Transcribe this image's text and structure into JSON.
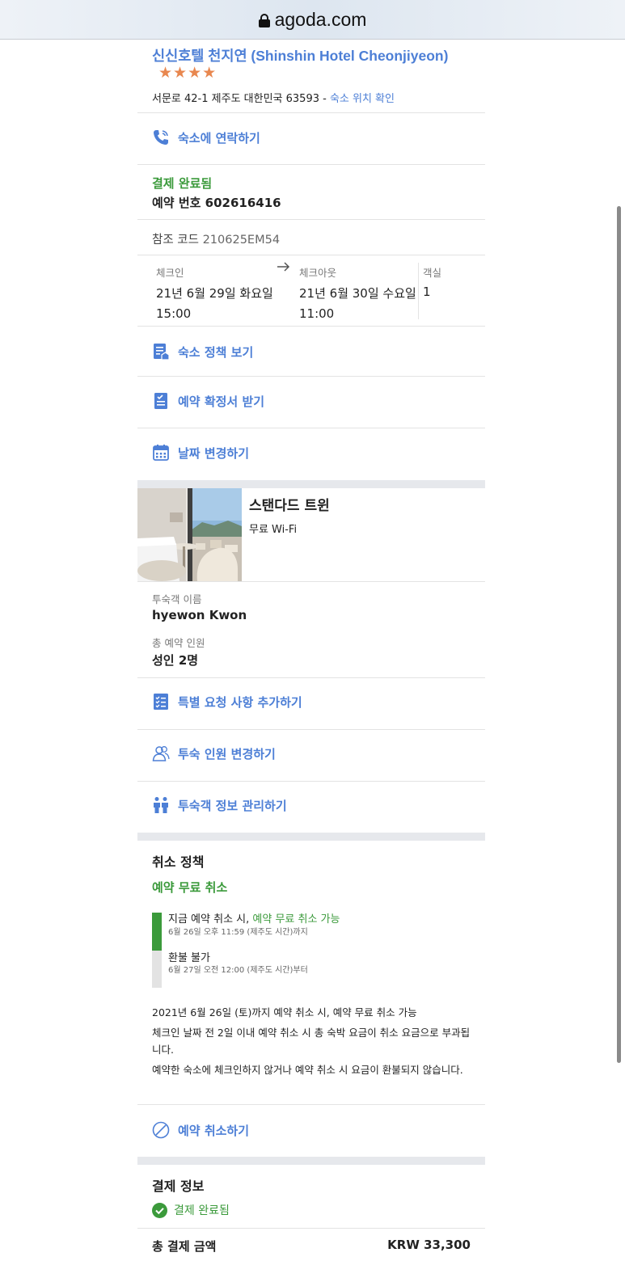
{
  "browser": {
    "domain": "agoda.com"
  },
  "hotel": {
    "name": "신신호텔 천지연 (Shinshin Hotel Cheonjiyeon)",
    "stars": "★★★★",
    "address": "서문로 42-1 제주도 대한민국 63593 - ",
    "map_link": "숙소 위치 확인"
  },
  "contact": {
    "label": "숙소에 연락하기"
  },
  "payment_status": {
    "status": "결제 완료됨",
    "booking_number": "예약 번호 602616416"
  },
  "reference": {
    "label": "참조 코드",
    "code": "210625EM54"
  },
  "stay": {
    "checkin_label": "체크인",
    "checkin_date": "21년 6월 29일 화요일",
    "checkin_time": "15:00",
    "checkout_label": "체크아웃",
    "checkout_date": "21년 6월 30일 수요일",
    "checkout_time": "11:00",
    "rooms_label": "객실",
    "rooms": "1"
  },
  "actions": {
    "policy": "숙소 정책 보기",
    "confirmation": "예약 확정서 받기",
    "change_dates": "날짜 변경하기",
    "special_request": "특별 요청 사항 추가하기",
    "change_guests": "투숙 인원 변경하기",
    "manage_guest": "투숙객 정보 관리하기",
    "cancel": "예약 취소하기"
  },
  "room": {
    "name": "스탠다드 트윈",
    "amenity": "무료 Wi-Fi"
  },
  "guest": {
    "name_label": "투숙객 이름",
    "name": "hyewon Kwon",
    "count_label": "총 예약 인원",
    "count": "성인 2명"
  },
  "cancellation": {
    "title": "취소 정책",
    "free": "예약 무료 취소",
    "step1_prefix": "지금 예약 취소 시, ",
    "step1_highlight": "예약 무료 취소 가능",
    "step1_sub": "6월 26일 오후 11:59 (제주도 시간)까지",
    "step2": "환불 불가",
    "step2_sub": "6월 27일 오전 12:00 (제주도 시간)부터",
    "p1": "2021년 6월 26일 (토)까지 예약 취소 시, 예약 무료 취소 가능",
    "p2": "체크인 날짜 전 2일 이내 예약 취소 시 총 숙박 요금이 취소 요금으로 부과됩니다.",
    "p3": "예약한 숙소에 체크인하지 않거나 예약 취소 시 요금이 환불되지 않습니다."
  },
  "payment": {
    "title": "결제 정보",
    "status": "결제 완료됨",
    "total_label": "총 결제 금액",
    "total": "KRW 33,300"
  },
  "colors": {
    "link": "#4d7fd6",
    "green": "#3b9a3b",
    "star": "#e8874f"
  }
}
